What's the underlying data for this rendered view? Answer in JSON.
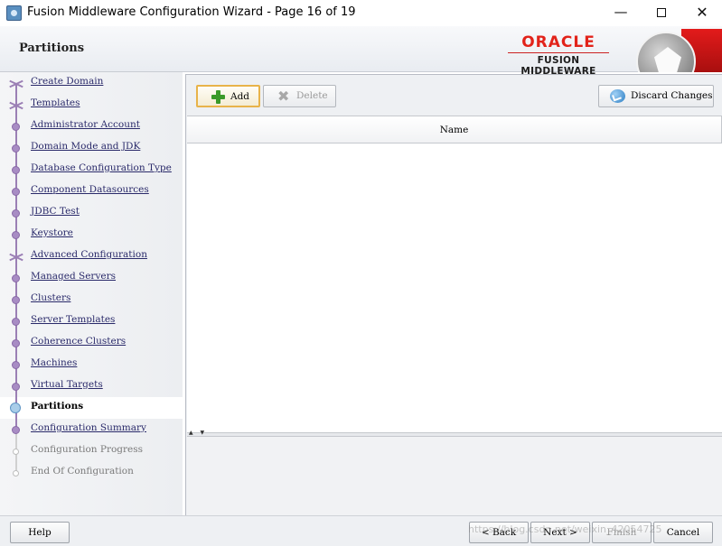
{
  "window": {
    "title": "Fusion Middleware Configuration Wizard - Page 16 of 19",
    "minimize": "—",
    "close": "✕"
  },
  "header": {
    "heading": "Partitions",
    "brand": {
      "oracle": "ORACLE",
      "fusion": "FUSION MIDDLEWARE",
      "accent_color": "#e2231a"
    }
  },
  "nav": {
    "items": [
      {
        "label": "Create Domain",
        "state": "done",
        "marker": "branch"
      },
      {
        "label": "Templates",
        "state": "done",
        "marker": "branch"
      },
      {
        "label": "Administrator Account",
        "state": "done",
        "marker": "dot"
      },
      {
        "label": "Domain Mode and JDK",
        "state": "done",
        "marker": "dot"
      },
      {
        "label": "Database Configuration Type",
        "state": "done",
        "marker": "dot"
      },
      {
        "label": "Component Datasources",
        "state": "done",
        "marker": "dot"
      },
      {
        "label": "JDBC Test",
        "state": "done",
        "marker": "dot"
      },
      {
        "label": "Keystore",
        "state": "done",
        "marker": "dot"
      },
      {
        "label": "Advanced Configuration",
        "state": "done",
        "marker": "branch"
      },
      {
        "label": "Managed Servers",
        "state": "done",
        "marker": "dot"
      },
      {
        "label": "Clusters",
        "state": "done",
        "marker": "dot"
      },
      {
        "label": "Server Templates",
        "state": "done",
        "marker": "dot"
      },
      {
        "label": "Coherence Clusters",
        "state": "done",
        "marker": "dot"
      },
      {
        "label": "Machines",
        "state": "done",
        "marker": "dot"
      },
      {
        "label": "Virtual Targets",
        "state": "done",
        "marker": "dot"
      },
      {
        "label": "Partitions",
        "state": "current",
        "marker": "current"
      },
      {
        "label": "Configuration Summary",
        "state": "done",
        "marker": "dot"
      },
      {
        "label": "Configuration Progress",
        "state": "future",
        "marker": "future"
      },
      {
        "label": "End Of Configuration",
        "state": "future",
        "marker": "future"
      }
    ]
  },
  "toolbar": {
    "add_label": "Add",
    "delete_label": "Delete",
    "discard_label": "Discard Changes"
  },
  "table": {
    "columns": [
      "Name"
    ],
    "rows": []
  },
  "splitter": {
    "arrows": "▲ ▼"
  },
  "footer": {
    "help_label": "Help",
    "back_label": "< Back",
    "next_label": "Next >",
    "finish_label": "Finish",
    "cancel_label": "Cancel",
    "watermark": "https://blog.csdn.net/weixin_42054725"
  }
}
